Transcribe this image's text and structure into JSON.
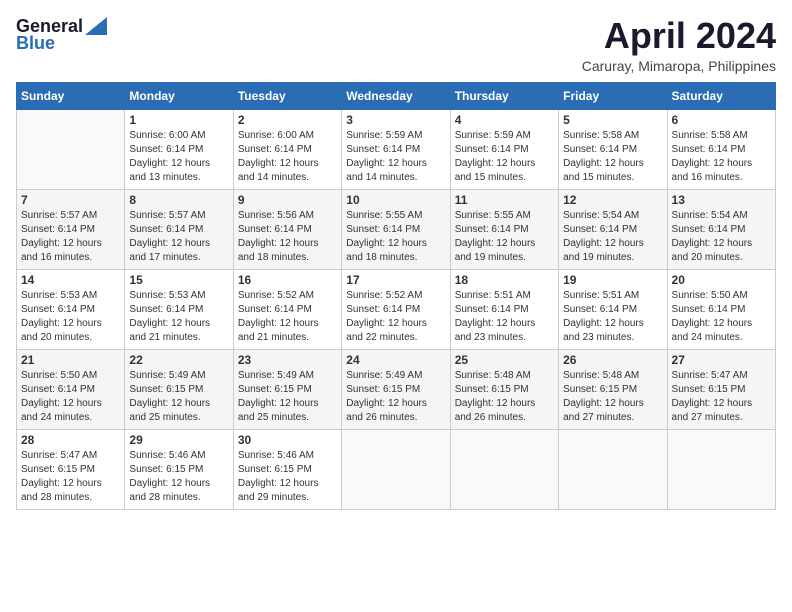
{
  "header": {
    "logo_general": "General",
    "logo_blue": "Blue",
    "month": "April 2024",
    "location": "Caruray, Mimaropa, Philippines"
  },
  "weekdays": [
    "Sunday",
    "Monday",
    "Tuesday",
    "Wednesday",
    "Thursday",
    "Friday",
    "Saturday"
  ],
  "weeks": [
    [
      {
        "day": "",
        "sunrise": "",
        "sunset": "",
        "daylight": ""
      },
      {
        "day": "1",
        "sunrise": "Sunrise: 6:00 AM",
        "sunset": "Sunset: 6:14 PM",
        "daylight": "Daylight: 12 hours and 13 minutes."
      },
      {
        "day": "2",
        "sunrise": "Sunrise: 6:00 AM",
        "sunset": "Sunset: 6:14 PM",
        "daylight": "Daylight: 12 hours and 14 minutes."
      },
      {
        "day": "3",
        "sunrise": "Sunrise: 5:59 AM",
        "sunset": "Sunset: 6:14 PM",
        "daylight": "Daylight: 12 hours and 14 minutes."
      },
      {
        "day": "4",
        "sunrise": "Sunrise: 5:59 AM",
        "sunset": "Sunset: 6:14 PM",
        "daylight": "Daylight: 12 hours and 15 minutes."
      },
      {
        "day": "5",
        "sunrise": "Sunrise: 5:58 AM",
        "sunset": "Sunset: 6:14 PM",
        "daylight": "Daylight: 12 hours and 15 minutes."
      },
      {
        "day": "6",
        "sunrise": "Sunrise: 5:58 AM",
        "sunset": "Sunset: 6:14 PM",
        "daylight": "Daylight: 12 hours and 16 minutes."
      }
    ],
    [
      {
        "day": "7",
        "sunrise": "Sunrise: 5:57 AM",
        "sunset": "Sunset: 6:14 PM",
        "daylight": "Daylight: 12 hours and 16 minutes."
      },
      {
        "day": "8",
        "sunrise": "Sunrise: 5:57 AM",
        "sunset": "Sunset: 6:14 PM",
        "daylight": "Daylight: 12 hours and 17 minutes."
      },
      {
        "day": "9",
        "sunrise": "Sunrise: 5:56 AM",
        "sunset": "Sunset: 6:14 PM",
        "daylight": "Daylight: 12 hours and 18 minutes."
      },
      {
        "day": "10",
        "sunrise": "Sunrise: 5:55 AM",
        "sunset": "Sunset: 6:14 PM",
        "daylight": "Daylight: 12 hours and 18 minutes."
      },
      {
        "day": "11",
        "sunrise": "Sunrise: 5:55 AM",
        "sunset": "Sunset: 6:14 PM",
        "daylight": "Daylight: 12 hours and 19 minutes."
      },
      {
        "day": "12",
        "sunrise": "Sunrise: 5:54 AM",
        "sunset": "Sunset: 6:14 PM",
        "daylight": "Daylight: 12 hours and 19 minutes."
      },
      {
        "day": "13",
        "sunrise": "Sunrise: 5:54 AM",
        "sunset": "Sunset: 6:14 PM",
        "daylight": "Daylight: 12 hours and 20 minutes."
      }
    ],
    [
      {
        "day": "14",
        "sunrise": "Sunrise: 5:53 AM",
        "sunset": "Sunset: 6:14 PM",
        "daylight": "Daylight: 12 hours and 20 minutes."
      },
      {
        "day": "15",
        "sunrise": "Sunrise: 5:53 AM",
        "sunset": "Sunset: 6:14 PM",
        "daylight": "Daylight: 12 hours and 21 minutes."
      },
      {
        "day": "16",
        "sunrise": "Sunrise: 5:52 AM",
        "sunset": "Sunset: 6:14 PM",
        "daylight": "Daylight: 12 hours and 21 minutes."
      },
      {
        "day": "17",
        "sunrise": "Sunrise: 5:52 AM",
        "sunset": "Sunset: 6:14 PM",
        "daylight": "Daylight: 12 hours and 22 minutes."
      },
      {
        "day": "18",
        "sunrise": "Sunrise: 5:51 AM",
        "sunset": "Sunset: 6:14 PM",
        "daylight": "Daylight: 12 hours and 23 minutes."
      },
      {
        "day": "19",
        "sunrise": "Sunrise: 5:51 AM",
        "sunset": "Sunset: 6:14 PM",
        "daylight": "Daylight: 12 hours and 23 minutes."
      },
      {
        "day": "20",
        "sunrise": "Sunrise: 5:50 AM",
        "sunset": "Sunset: 6:14 PM",
        "daylight": "Daylight: 12 hours and 24 minutes."
      }
    ],
    [
      {
        "day": "21",
        "sunrise": "Sunrise: 5:50 AM",
        "sunset": "Sunset: 6:14 PM",
        "daylight": "Daylight: 12 hours and 24 minutes."
      },
      {
        "day": "22",
        "sunrise": "Sunrise: 5:49 AM",
        "sunset": "Sunset: 6:15 PM",
        "daylight": "Daylight: 12 hours and 25 minutes."
      },
      {
        "day": "23",
        "sunrise": "Sunrise: 5:49 AM",
        "sunset": "Sunset: 6:15 PM",
        "daylight": "Daylight: 12 hours and 25 minutes."
      },
      {
        "day": "24",
        "sunrise": "Sunrise: 5:49 AM",
        "sunset": "Sunset: 6:15 PM",
        "daylight": "Daylight: 12 hours and 26 minutes."
      },
      {
        "day": "25",
        "sunrise": "Sunrise: 5:48 AM",
        "sunset": "Sunset: 6:15 PM",
        "daylight": "Daylight: 12 hours and 26 minutes."
      },
      {
        "day": "26",
        "sunrise": "Sunrise: 5:48 AM",
        "sunset": "Sunset: 6:15 PM",
        "daylight": "Daylight: 12 hours and 27 minutes."
      },
      {
        "day": "27",
        "sunrise": "Sunrise: 5:47 AM",
        "sunset": "Sunset: 6:15 PM",
        "daylight": "Daylight: 12 hours and 27 minutes."
      }
    ],
    [
      {
        "day": "28",
        "sunrise": "Sunrise: 5:47 AM",
        "sunset": "Sunset: 6:15 PM",
        "daylight": "Daylight: 12 hours and 28 minutes."
      },
      {
        "day": "29",
        "sunrise": "Sunrise: 5:46 AM",
        "sunset": "Sunset: 6:15 PM",
        "daylight": "Daylight: 12 hours and 28 minutes."
      },
      {
        "day": "30",
        "sunrise": "Sunrise: 5:46 AM",
        "sunset": "Sunset: 6:15 PM",
        "daylight": "Daylight: 12 hours and 29 minutes."
      },
      {
        "day": "",
        "sunrise": "",
        "sunset": "",
        "daylight": ""
      },
      {
        "day": "",
        "sunrise": "",
        "sunset": "",
        "daylight": ""
      },
      {
        "day": "",
        "sunrise": "",
        "sunset": "",
        "daylight": ""
      },
      {
        "day": "",
        "sunrise": "",
        "sunset": "",
        "daylight": ""
      }
    ]
  ]
}
